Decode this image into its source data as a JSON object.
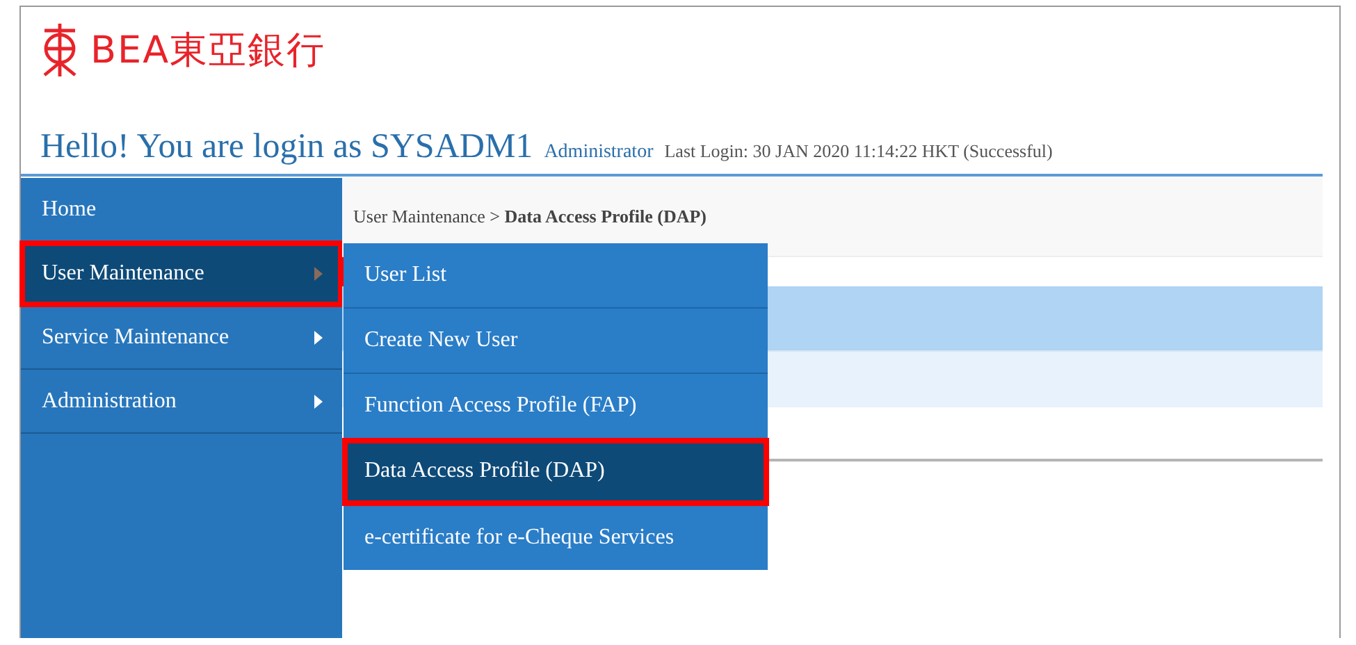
{
  "logo": {
    "text": "BEA東亞銀行"
  },
  "greeting": {
    "title": "Hello! You are login as SYSADM1",
    "role": "Administrator",
    "last_login": "Last Login: 30 JAN 2020 11:14:22 HKT (Successful)"
  },
  "sidebar": {
    "items": [
      {
        "label": "Home",
        "submenu": false,
        "selected": false
      },
      {
        "label": "User Maintenance",
        "submenu": true,
        "selected": true
      },
      {
        "label": "Service Maintenance",
        "submenu": true,
        "selected": false
      },
      {
        "label": "Administration",
        "submenu": true,
        "selected": false
      }
    ]
  },
  "submenu": {
    "items": [
      {
        "label": "User List",
        "selected": false
      },
      {
        "label": "Create New User",
        "selected": false
      },
      {
        "label": "Function Access Profile (FAP)",
        "selected": false
      },
      {
        "label": "Data Access Profile (DAP)",
        "selected": true
      },
      {
        "label": "e-certificate for e-Cheque Services",
        "selected": false
      }
    ]
  },
  "breadcrumb": {
    "parent": "User Maintenance > ",
    "current": "Data Access Profile (DAP)"
  }
}
